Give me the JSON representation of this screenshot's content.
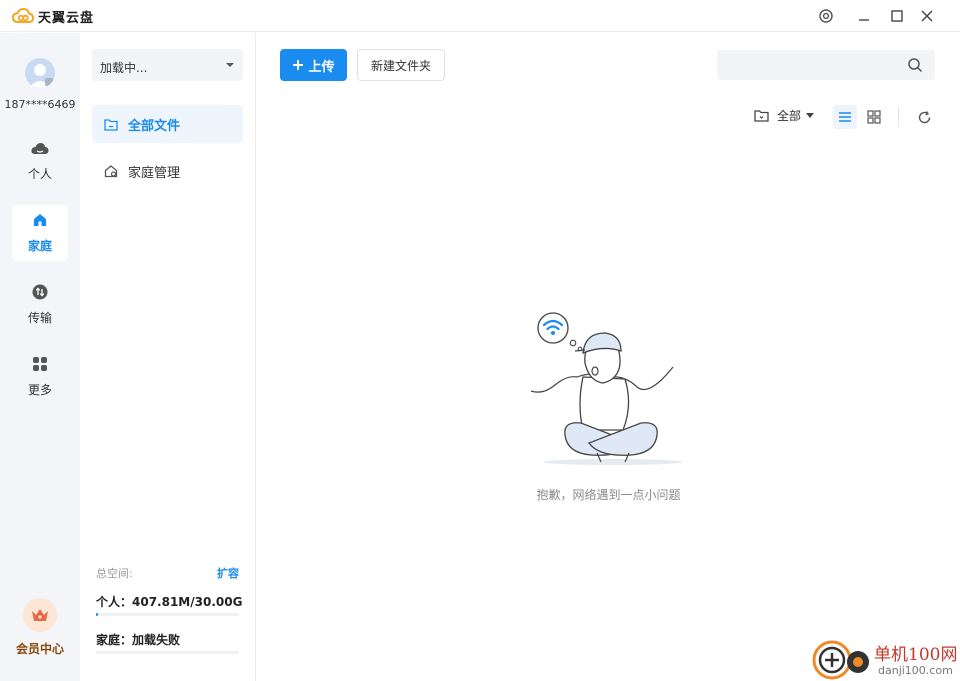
{
  "app": {
    "title": "天翼云盘"
  },
  "user": {
    "phone": "187****6469"
  },
  "rail": {
    "items": [
      {
        "label": "个人"
      },
      {
        "label": "家庭"
      },
      {
        "label": "传输"
      },
      {
        "label": "更多"
      }
    ],
    "vip_label": "会员中心"
  },
  "panel": {
    "dropdown_value": "加载中...",
    "nav": [
      {
        "label": "全部文件"
      },
      {
        "label": "家庭管理"
      }
    ],
    "storage": {
      "heading": "总空间:",
      "expand_label": "扩容",
      "personal": "个人：407.81M/30.00G",
      "personal_fraction": 0.013,
      "family": "家庭：加载失败"
    }
  },
  "toolbar": {
    "upload_label": "上传",
    "new_folder_label": "新建文件夹",
    "search_placeholder": "",
    "filter_label": "全部"
  },
  "empty_state": {
    "message": "抱歉，网络遇到一点小问题"
  },
  "watermark": {
    "title": "单机100网",
    "subtitle": "danji100.com"
  },
  "colors": {
    "accent": "#1a8cf0",
    "rail_bg": "#f3f5f9",
    "vip": "#8b4a0e"
  }
}
